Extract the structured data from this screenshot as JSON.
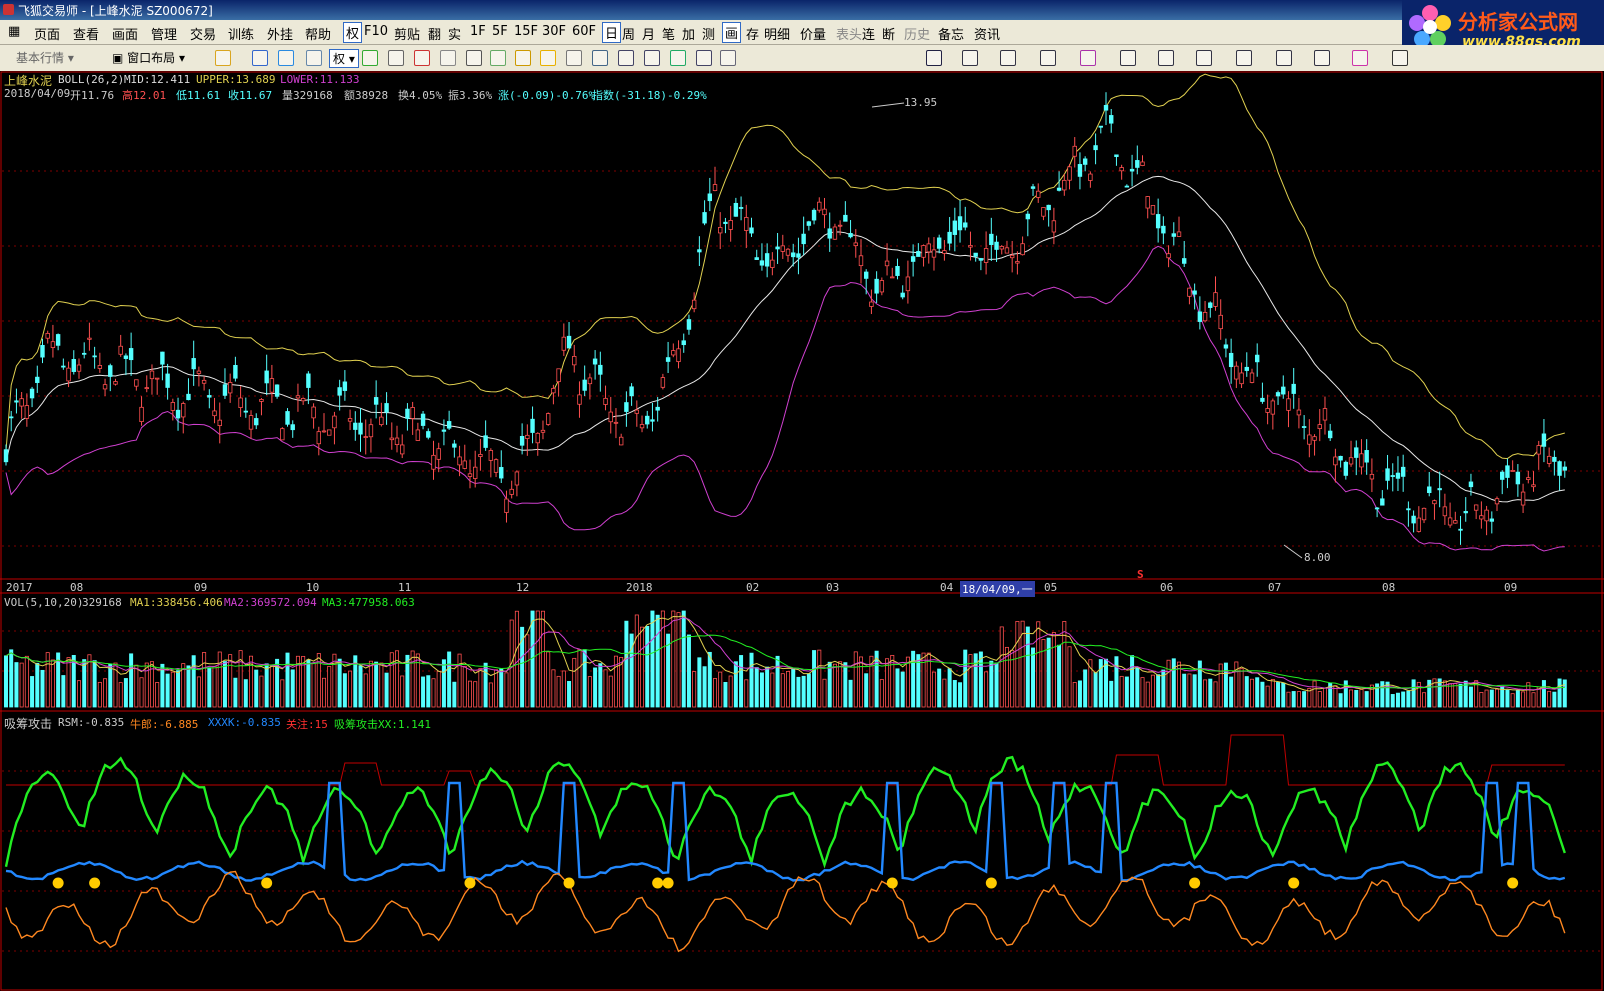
{
  "window": {
    "title": "飞狐交易师 - [上峰水泥 SZ000672]"
  },
  "logo": {
    "name": "分析家公式网",
    "url": "www.88gs.com"
  },
  "menu": [
    "页面",
    "查看",
    "画面",
    "管理",
    "交易",
    "训练",
    "外挂",
    "帮助",
    "权",
    "F10",
    "剪贴",
    "翻",
    "实",
    "1F",
    "5F",
    "15F",
    "30F",
    "60F",
    "日",
    "周",
    "月",
    "笔",
    "加",
    "测",
    "画",
    "存",
    "明细",
    "价量",
    "表头",
    "连",
    "断",
    "历史",
    "备忘",
    "资讯"
  ],
  "toolbar": {
    "basic_quotes": "基本行情",
    "window_layout": "窗口布局",
    "rights": "权"
  },
  "main_panel": {
    "stock_name": "上峰水泥",
    "indicator": "BOLL(26,2)",
    "mid": "MID:12.411",
    "upper": "UPPER:13.689",
    "lower": "LOWER:11.133",
    "info_date": "2018/04/09",
    "info_open": "开11.76",
    "info_high": "高12.01",
    "info_low": "低11.61",
    "info_close": "收11.67",
    "info_vol": "量329168",
    "info_amt": "额38928",
    "info_turn": "换4.05%",
    "info_amp": "振3.36%",
    "info_chg": "涨(-0.09)-0.76%",
    "info_index": "指数(-31.18)-0.29%",
    "high_mark": "13.95",
    "low_mark": "8.00",
    "marker_s": "S"
  },
  "time_axis": [
    "2017",
    "08",
    "09",
    "10",
    "11",
    "12",
    "2018",
    "02",
    "03",
    "04",
    "18/04/09,一",
    "05",
    "06",
    "07",
    "08",
    "09"
  ],
  "vol_panel": {
    "indicator": "VOL(5,10,20)",
    "value": "329168",
    "ma1": "MA1:338456.406",
    "ma2": "MA2:369572.094",
    "ma3": "MA3:477958.063"
  },
  "sub_panel": {
    "indicator": "吸筹攻击",
    "rsm": "RSM:-0.835",
    "niulang": "牛郎:-6.885",
    "xxxk": "XXXK:-0.835",
    "guanzhu": "关注:15",
    "xx": "吸筹攻击XX:1.141"
  },
  "colors": {
    "up": "#ff5050",
    "down": "#54ffff",
    "mid": "#e8e8e8",
    "upper": "#e0d050",
    "lower": "#d040d0",
    "green": "#22ee22",
    "blue": "#2288ff",
    "orange": "#ff8820",
    "darkred": "#c00000"
  }
}
